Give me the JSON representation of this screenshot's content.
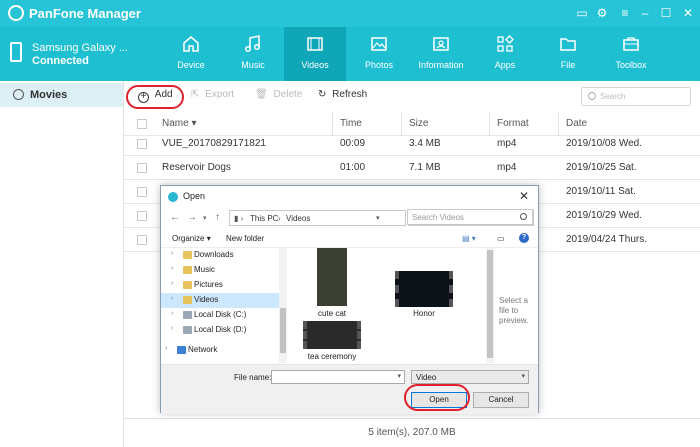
{
  "app": {
    "title": "PanFone Manager"
  },
  "device": {
    "name": "Samsung Galaxy ...",
    "status": "Connected"
  },
  "nav": {
    "tabs": [
      {
        "label": "Device"
      },
      {
        "label": "Music"
      },
      {
        "label": "Videos"
      },
      {
        "label": "Photos"
      },
      {
        "label": "Information"
      },
      {
        "label": "Apps"
      },
      {
        "label": "File"
      },
      {
        "label": "Toolbox"
      }
    ],
    "active": "Videos"
  },
  "sidebar": {
    "items": [
      {
        "label": "Movies",
        "icon": "disc-icon"
      }
    ]
  },
  "toolbar": {
    "add": "Add",
    "export": "Export",
    "delete": "Delete",
    "refresh": "Refresh",
    "search_placeholder": "Search"
  },
  "table": {
    "columns": [
      "Name",
      "Time",
      "Size",
      "Format",
      "Date"
    ],
    "rows": [
      {
        "name": "VUE_20170829171821",
        "time": "00:09",
        "size": "3.4 MB",
        "format": "mp4",
        "date": "2019/10/08 Wed."
      },
      {
        "name": "Reservoir Dogs",
        "time": "01:00",
        "size": "7.1 MB",
        "format": "mp4",
        "date": "2019/10/25 Sat."
      },
      {
        "name": "",
        "time": "",
        "size": "",
        "format": "",
        "date": "2019/10/11 Sat."
      },
      {
        "name": "",
        "time": "",
        "size": "",
        "format": "",
        "date": "2019/10/29 Wed."
      },
      {
        "name": "",
        "time": "",
        "size": "",
        "format": "",
        "date": "2019/04/24 Thurs."
      }
    ]
  },
  "status": {
    "text": "5 item(s), 207.0 MB"
  },
  "dialog": {
    "title": "Open",
    "path": [
      "This PC",
      "Videos"
    ],
    "search_placeholder": "Search Videos",
    "organize": "Organize",
    "new_folder": "New folder",
    "nav_items": [
      {
        "label": "Downloads"
      },
      {
        "label": "Music"
      },
      {
        "label": "Pictures"
      },
      {
        "label": "Videos"
      },
      {
        "label": "Local Disk (C:)"
      },
      {
        "label": "Local Disk (D:)"
      },
      {
        "label": "Network"
      }
    ],
    "files": [
      {
        "name": "cute cat"
      },
      {
        "name": "Honor"
      },
      {
        "name": "tea ceremony"
      }
    ],
    "preview_text": "Select a file to preview.",
    "file_name_label": "File name:",
    "file_name_value": "",
    "file_type": "Video",
    "open_label": "Open",
    "cancel_label": "Cancel"
  },
  "colors": {
    "accent": "#26c4d6",
    "highlight_oval": "#e0202a"
  }
}
